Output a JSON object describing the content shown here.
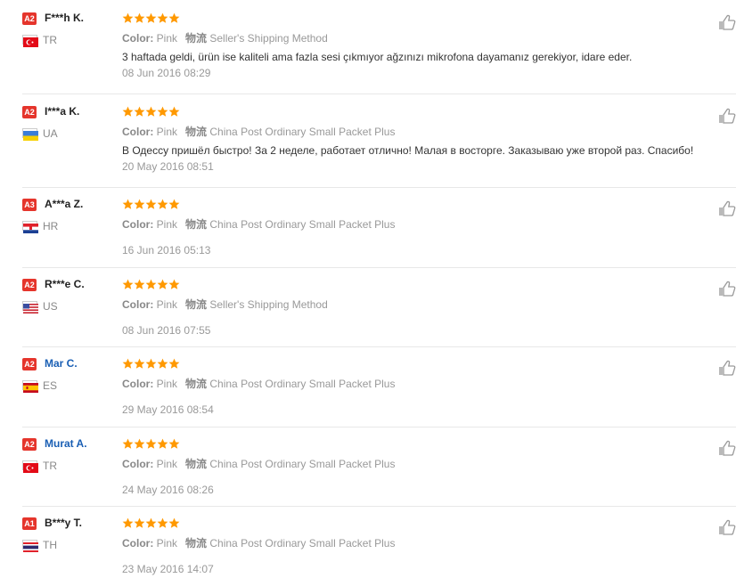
{
  "labels": {
    "color": "Color:",
    "shipping": "物流"
  },
  "colors": {
    "badge": "#e5352c",
    "star": "#ff9900",
    "name_link": "#1a5fb4"
  },
  "reviews": [
    {
      "level": "A2",
      "name": "F***h K.",
      "name_is_link": false,
      "country": "TR",
      "flag": "turkey-flag-icon",
      "rating": 5,
      "color": "Pink",
      "shipping": "Seller's Shipping Method",
      "comment": "3 haftada geldi, ürün ise kaliteli ama fazla sesi çıkmıyor ağzınızı mikrofona dayamanız gerekiyor, idare eder.",
      "date": "08 Jun 2016 08:29"
    },
    {
      "level": "A2",
      "name": "I***a K.",
      "name_is_link": false,
      "country": "UA",
      "flag": "ukraine-flag-icon",
      "rating": 5,
      "color": "Pink",
      "shipping": "China Post Ordinary Small Packet Plus",
      "comment": "В Одессу пришёл быстро! За 2 неделе, работает отлично! Малая в восторге. Заказываю уже второй раз. Спасибо!",
      "date": "20 May 2016 08:51"
    },
    {
      "level": "A3",
      "name": "A***a Z.",
      "name_is_link": false,
      "country": "HR",
      "flag": "croatia-flag-icon",
      "rating": 5,
      "color": "Pink",
      "shipping": "China Post Ordinary Small Packet Plus",
      "comment": "",
      "date": "16 Jun 2016 05:13"
    },
    {
      "level": "A2",
      "name": "R***e C.",
      "name_is_link": false,
      "country": "US",
      "flag": "usa-flag-icon",
      "rating": 5,
      "color": "Pink",
      "shipping": "Seller's Shipping Method",
      "comment": "",
      "date": "08 Jun 2016 07:55"
    },
    {
      "level": "A2",
      "name": "Mar C.",
      "name_is_link": true,
      "country": "ES",
      "flag": "spain-flag-icon",
      "rating": 5,
      "color": "Pink",
      "shipping": "China Post Ordinary Small Packet Plus",
      "comment": "",
      "date": "29 May 2016 08:54"
    },
    {
      "level": "A2",
      "name": "Murat A.",
      "name_is_link": true,
      "country": "TR",
      "flag": "turkey-flag-icon",
      "rating": 5,
      "color": "Pink",
      "shipping": "China Post Ordinary Small Packet Plus",
      "comment": "",
      "date": "24 May 2016 08:26"
    },
    {
      "level": "A1",
      "name": "B***y T.",
      "name_is_link": false,
      "country": "TH",
      "flag": "thailand-flag-icon",
      "rating": 5,
      "color": "Pink",
      "shipping": "China Post Ordinary Small Packet Plus",
      "comment": "",
      "date": "23 May 2016 14:07"
    }
  ]
}
